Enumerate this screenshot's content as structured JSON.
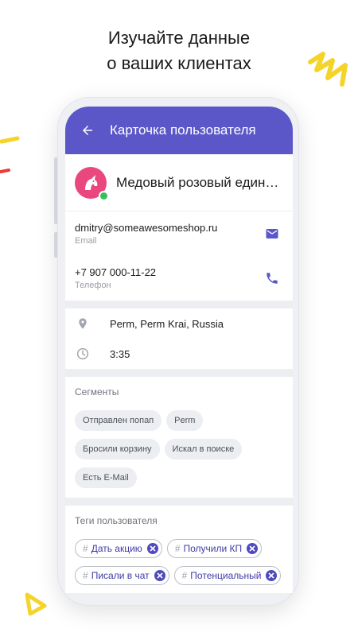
{
  "headline": {
    "line1": "Изучайте данные",
    "line2": "о ваших клиентах"
  },
  "colors": {
    "accent": "#5b57c9",
    "avatar": "#e9477e",
    "online": "#35c15a",
    "deco_yellow": "#f5d42a",
    "deco_red": "#ea3b3b"
  },
  "appbar": {
    "back_icon": "arrow-left-icon",
    "title": "Карточка пользователя"
  },
  "profile": {
    "avatar_icon": "unicorn-icon",
    "name": "Медовый розовый единорог",
    "status": "online"
  },
  "contacts": [
    {
      "value": "dmitry@someawesomeshop.ru",
      "label": "Email",
      "icon": "mail-icon"
    },
    {
      "value": "+7 907 000-11-22",
      "label": "Телефон",
      "icon": "phone-icon"
    }
  ],
  "info": [
    {
      "icon": "location-pin-icon",
      "text": "Perm, Perm Krai, Russia"
    },
    {
      "icon": "clock-icon",
      "text": "3:35"
    }
  ],
  "segments": {
    "title": "Сегменты",
    "items": [
      "Отправлен попап",
      "Perm",
      "Бросили корзину",
      "Искал в поиске",
      "Есть E-Mail"
    ]
  },
  "tags": {
    "title": "Теги пользователя",
    "items": [
      "Дать акцию",
      "Получили КП",
      "Писали в чат",
      "Потенциальный"
    ]
  }
}
